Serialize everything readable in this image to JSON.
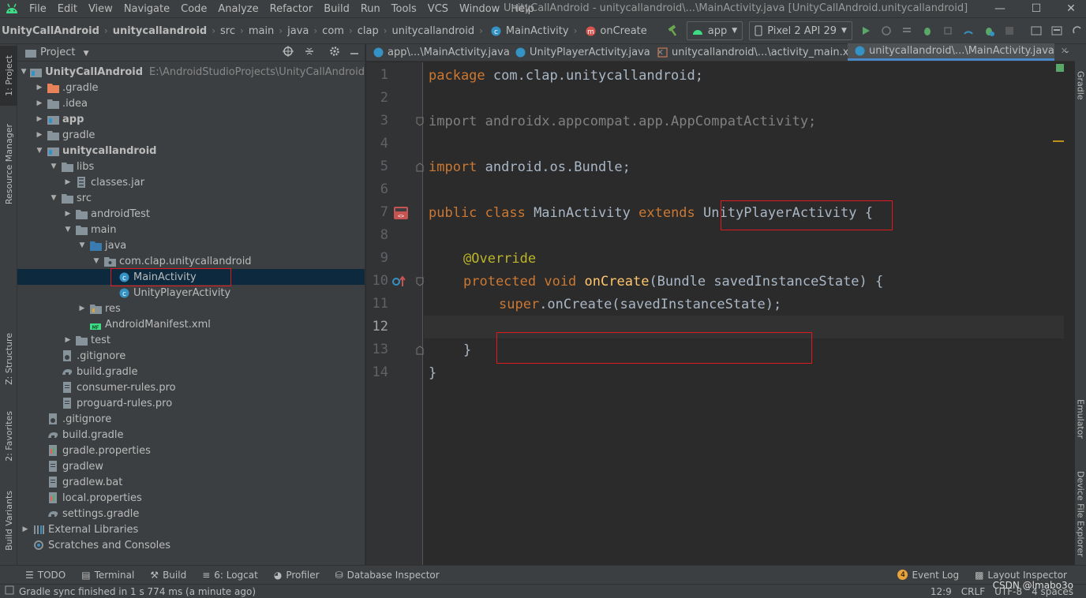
{
  "menubar": {
    "items": [
      "File",
      "Edit",
      "View",
      "Navigate",
      "Code",
      "Analyze",
      "Refactor",
      "Build",
      "Run",
      "Tools",
      "VCS",
      "Window",
      "Help"
    ],
    "window_title": "UnityCallAndroid - unitycallandroid\\...\\MainActivity.java [UnityCallAndroid.unitycallandroid]"
  },
  "navbar": {
    "breadcrumbs": [
      "UnityCallAndroid",
      "unitycallandroid",
      "src",
      "main",
      "java",
      "com",
      "clap",
      "unitycallandroid",
      "MainActivity",
      "onCreate"
    ],
    "run_config": "app",
    "device": "Pixel 2 API 29"
  },
  "left_strip": {
    "project": "1: Project",
    "resource_manager": "Resource Manager",
    "structure": "Z: Structure",
    "favorites": "2: Favorites",
    "build_variants": "Build Variants"
  },
  "right_strip": {
    "gradle": "Gradle",
    "emulator": "Emulator",
    "device_file_explorer": "Device File Explorer"
  },
  "project_panel": {
    "title": "Project",
    "tree": [
      {
        "label": "UnityCallAndroid",
        "extra": "E:\\AndroidStudioProjects\\UnityCallAndroid",
        "bold": true
      },
      {
        "label": ".gradle"
      },
      {
        "label": ".idea"
      },
      {
        "label": "app",
        "bold": true
      },
      {
        "label": "gradle"
      },
      {
        "label": "unitycallandroid",
        "bold": true
      },
      {
        "label": "libs"
      },
      {
        "label": "classes.jar"
      },
      {
        "label": "src"
      },
      {
        "label": "androidTest"
      },
      {
        "label": "main"
      },
      {
        "label": "java"
      },
      {
        "label": "com.clap.unitycallandroid"
      },
      {
        "label": "MainActivity"
      },
      {
        "label": "UnityPlayerActivity"
      },
      {
        "label": "res"
      },
      {
        "label": "AndroidManifest.xml"
      },
      {
        "label": "test"
      },
      {
        "label": ".gitignore"
      },
      {
        "label": "build.gradle"
      },
      {
        "label": "consumer-rules.pro"
      },
      {
        "label": "proguard-rules.pro"
      },
      {
        "label": ".gitignore"
      },
      {
        "label": "build.gradle"
      },
      {
        "label": "gradle.properties"
      },
      {
        "label": "gradlew"
      },
      {
        "label": "gradlew.bat"
      },
      {
        "label": "local.properties"
      },
      {
        "label": "settings.gradle"
      },
      {
        "label": "External Libraries"
      },
      {
        "label": "Scratches and Consoles"
      }
    ]
  },
  "editor": {
    "tabs": [
      {
        "label": "app\\...\\MainActivity.java"
      },
      {
        "label": "UnityPlayerActivity.java"
      },
      {
        "label": "unitycallandroid\\...\\activity_main.xml"
      },
      {
        "label": "unitycallandroid\\...\\MainActivity.java",
        "active": true
      }
    ],
    "line_numbers": [
      "1",
      "2",
      "3",
      "4",
      "5",
      "6",
      "7",
      "8",
      "9",
      "10",
      "11",
      "12",
      "13",
      "14"
    ],
    "code": {
      "l1_kw": "package",
      "l1_rest": " com.clap.unitycallandroid;",
      "l3_kw": "import",
      "l3_rest": " androidx.appcompat.app.AppCompatActivity;",
      "l5_kw": "import",
      "l5_rest": " android.os.Bundle;",
      "l7_kw1": "public class",
      "l7_name": " MainActivity ",
      "l7_kw2": "extends",
      "l7_sp": " ",
      "l7_super": "UnityPlayerActivity",
      "l7_brace": " {",
      "l9_ann": "@Override",
      "l10_kw": "protected void",
      "l10_sp": " ",
      "l10_fn": "onCreate",
      "l10_rest": "(Bundle savedInstanceState) {",
      "l11_kw": "super",
      "l11_rest": ".onCreate(savedInstanceState);",
      "l13": "}",
      "l14": "}"
    }
  },
  "bottom_tools": {
    "todo": "TODO",
    "terminal": "Terminal",
    "build": "Build",
    "logcat": "6: Logcat",
    "profiler": "Profiler",
    "database_inspector": "Database Inspector",
    "event_log": "Event Log",
    "event_log_count": "4",
    "layout_inspector": "Layout Inspector"
  },
  "statusbar": {
    "message": "Gradle sync finished in 1 s 774 ms (a minute ago)",
    "position": "12:9",
    "line_sep": "CRLF",
    "encoding": "UTF-8",
    "indent": "4 spaces",
    "watermark": "CSDN @lmabo3o"
  },
  "colors": {
    "accent": "#4a88c7",
    "highlight_box": "#e0191e",
    "keyword": "#cc7832",
    "annotation": "#bbb529",
    "method": "#ffc66d",
    "android_green": "#3ddc84"
  }
}
